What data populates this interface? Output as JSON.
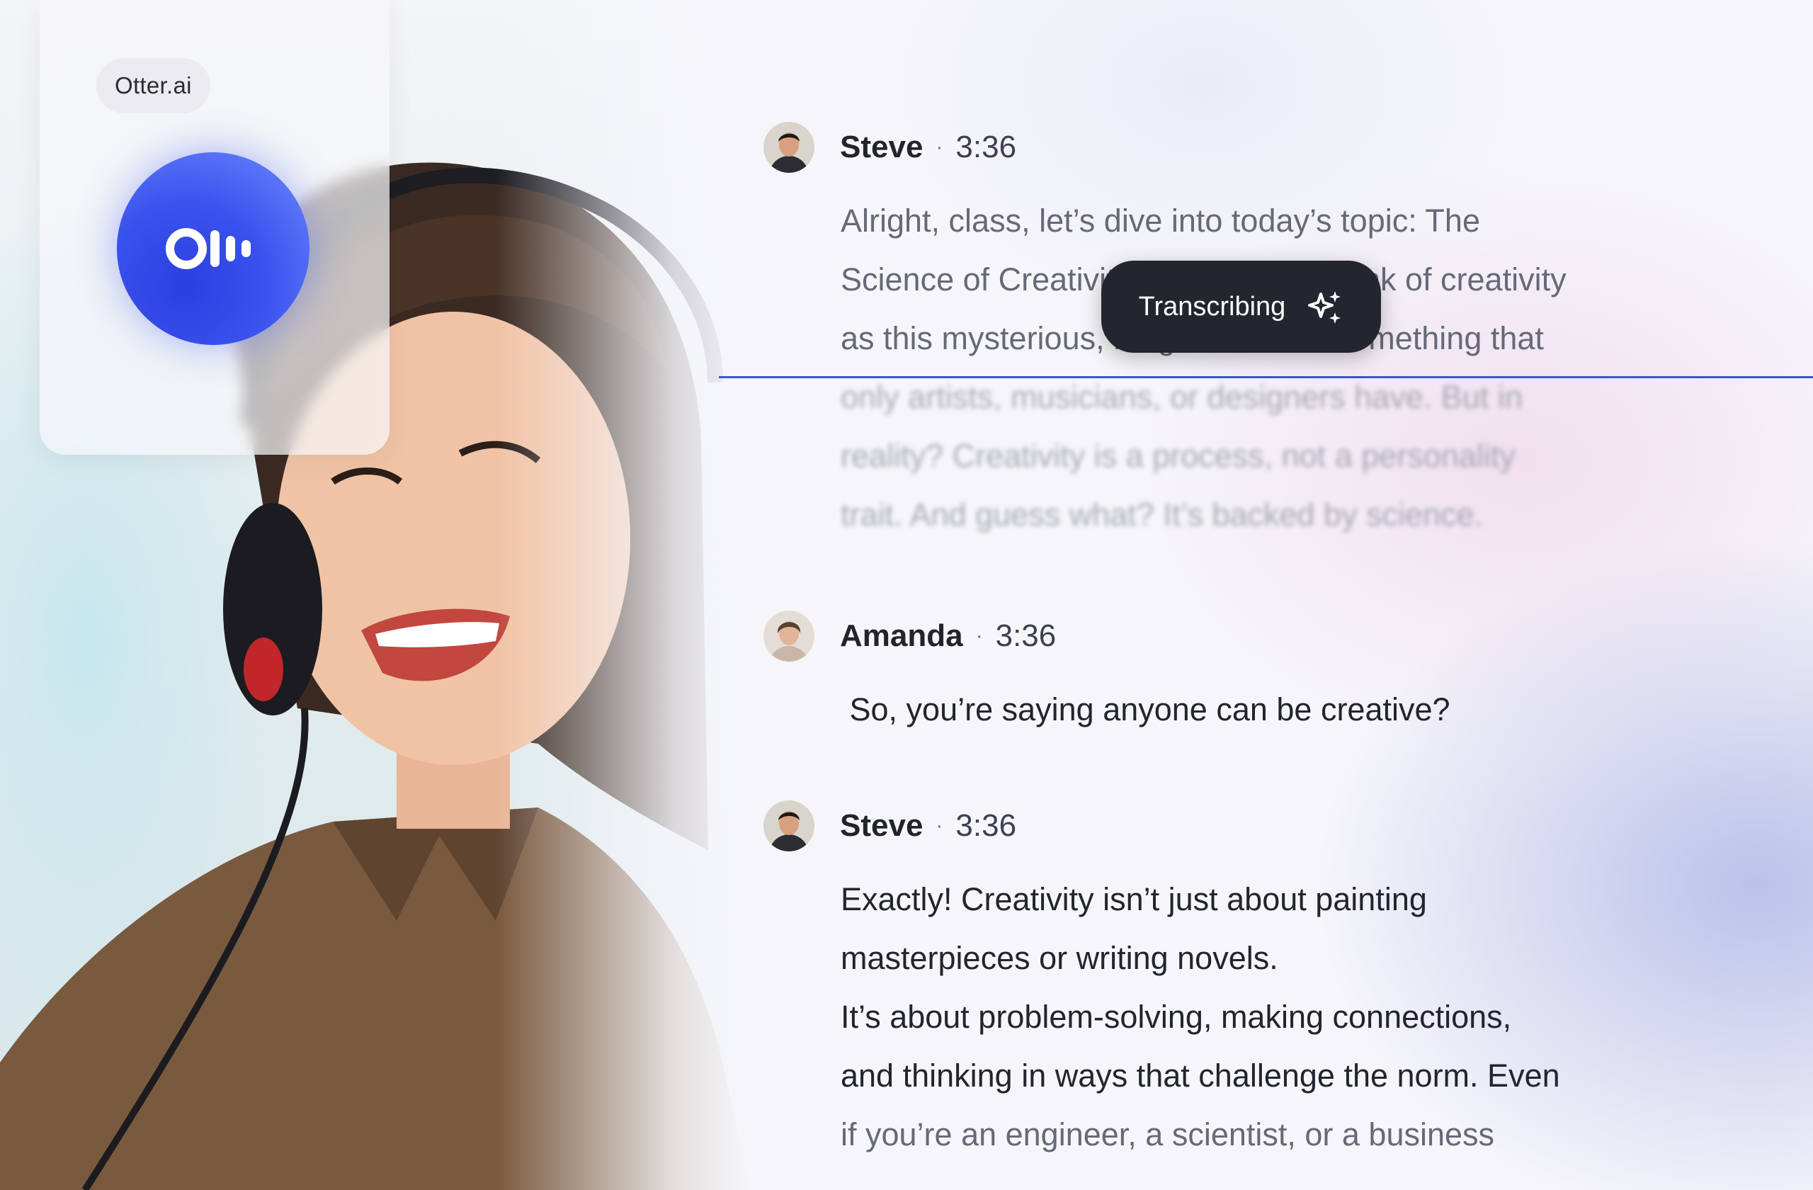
{
  "brand": {
    "name": "Otter.ai"
  },
  "status": {
    "label": "Transcribing",
    "icon": "sparkle-icon"
  },
  "colors": {
    "accent": "#3a55d6",
    "logo_blue": "#3a52ee",
    "pill_dark": "#23262f"
  },
  "messages": [
    {
      "speaker": "Steve",
      "time": "3:36",
      "lines": [
        "Alright, class, let’s dive into today’s topic: The",
        "Science of Creativity. Many of you think of creativity",
        "as this mysterious, magical force—something that",
        "only artists, musicians, or designers have. But in",
        "reality? Creativity is a process, not a personality",
        "trait. And guess what? It’s backed by science."
      ]
    },
    {
      "speaker": "Amanda",
      "time": "3:36",
      "lines": [
        " So, you’re saying anyone can be creative?"
      ]
    },
    {
      "speaker": "Steve",
      "time": "3:36",
      "lines": [
        "Exactly! Creativity isn’t just about painting",
        "masterpieces or writing novels.",
        "It’s about problem-solving, making connections,",
        "and thinking in ways that challenge the norm. Even",
        "if you’re an engineer, a scientist, or a business"
      ]
    }
  ]
}
